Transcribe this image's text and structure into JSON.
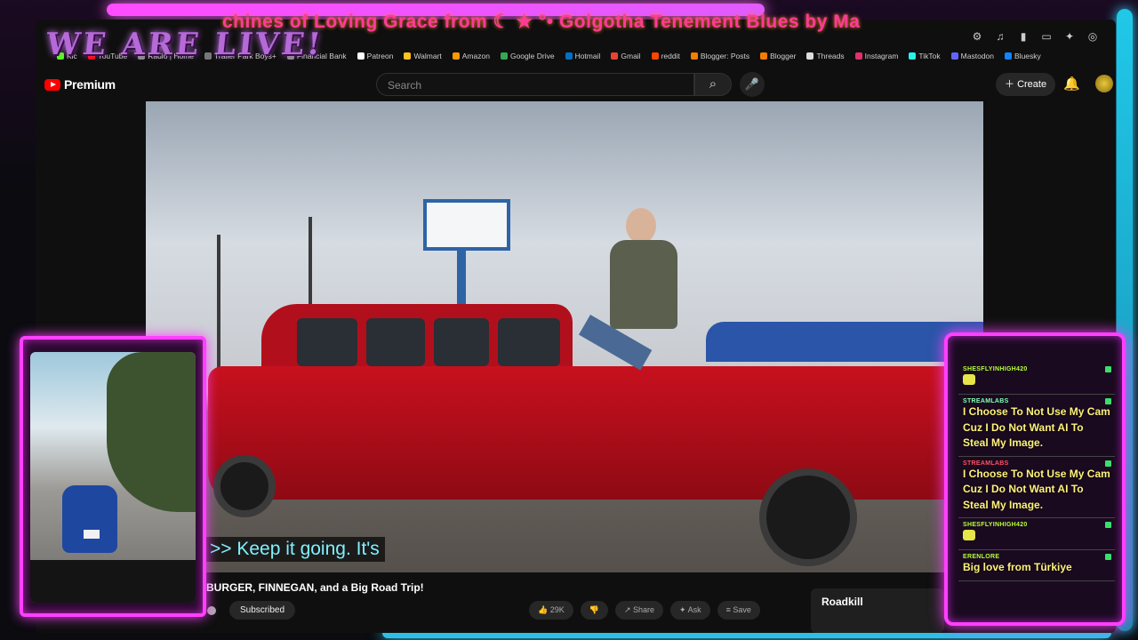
{
  "overlay": {
    "ticker_text": "chines of Loving Grace from ☾ ★ °• Golgotha Tenement Blues by Ma",
    "live_banner": "WE ARE LIVE!"
  },
  "bookmarks": [
    {
      "label": "Kic",
      "color": "#53fc18"
    },
    {
      "label": "YouTube",
      "color": "#ff0000"
    },
    {
      "label": "Radio | Home",
      "color": "#888888"
    },
    {
      "label": "Trailer Park Boys+",
      "color": "#777777"
    },
    {
      "label": "Financial Bank",
      "color": "#888888"
    },
    {
      "label": "Patreon",
      "color": "#ffffff"
    },
    {
      "label": "Walmart",
      "color": "#ffc220"
    },
    {
      "label": "Amazon",
      "color": "#ff9900"
    },
    {
      "label": "Google Drive",
      "color": "#34a853"
    },
    {
      "label": "Hotmail",
      "color": "#0072c6"
    },
    {
      "label": "Gmail",
      "color": "#ea4335"
    },
    {
      "label": "reddit",
      "color": "#ff4500"
    },
    {
      "label": "Blogger: Posts",
      "color": "#f57d00"
    },
    {
      "label": "Blogger",
      "color": "#f57d00"
    },
    {
      "label": "Threads",
      "color": "#dddddd"
    },
    {
      "label": "Instagram",
      "color": "#e1306c"
    },
    {
      "label": "TikTok",
      "color": "#25f4ee"
    },
    {
      "label": "Mastodon",
      "color": "#6364ff"
    },
    {
      "label": "Bluesky",
      "color": "#1185fe"
    }
  ],
  "youtube": {
    "logo_text": "Premium",
    "search_placeholder": "Search",
    "create_label": "Create",
    "caption": ">> Keep it going. It's",
    "video_title": "BURGER, FINNEGAN, and a Big Road Trip!",
    "subscribed_label": "Subscribed",
    "actions": [
      "29K",
      "",
      "Share",
      "Ask",
      "Save"
    ],
    "up_next_title": "Roadkill"
  },
  "chat": [
    {
      "user": "SHESFLYINHIGH420",
      "user_color": "#b8ff3a",
      "text": "",
      "emote": true
    },
    {
      "user": "STREAMLABS",
      "user_color": "#80ffb0",
      "text": "I Choose To Not Use My Cam Cuz I Do Not Want AI To Steal My Image.",
      "emote": false
    },
    {
      "user": "STREAMLABS",
      "user_color": "#ff5060",
      "text": "I Choose To Not Use My Cam Cuz I Do Not Want AI To Steal My Image.",
      "emote": false
    },
    {
      "user": "SHESFLYINHIGH420",
      "user_color": "#b8ff3a",
      "text": "",
      "emote": true
    },
    {
      "user": "ERENLORE",
      "user_color": "#b8ff3a",
      "text": "Big love from Türkiye",
      "emote": false
    }
  ]
}
